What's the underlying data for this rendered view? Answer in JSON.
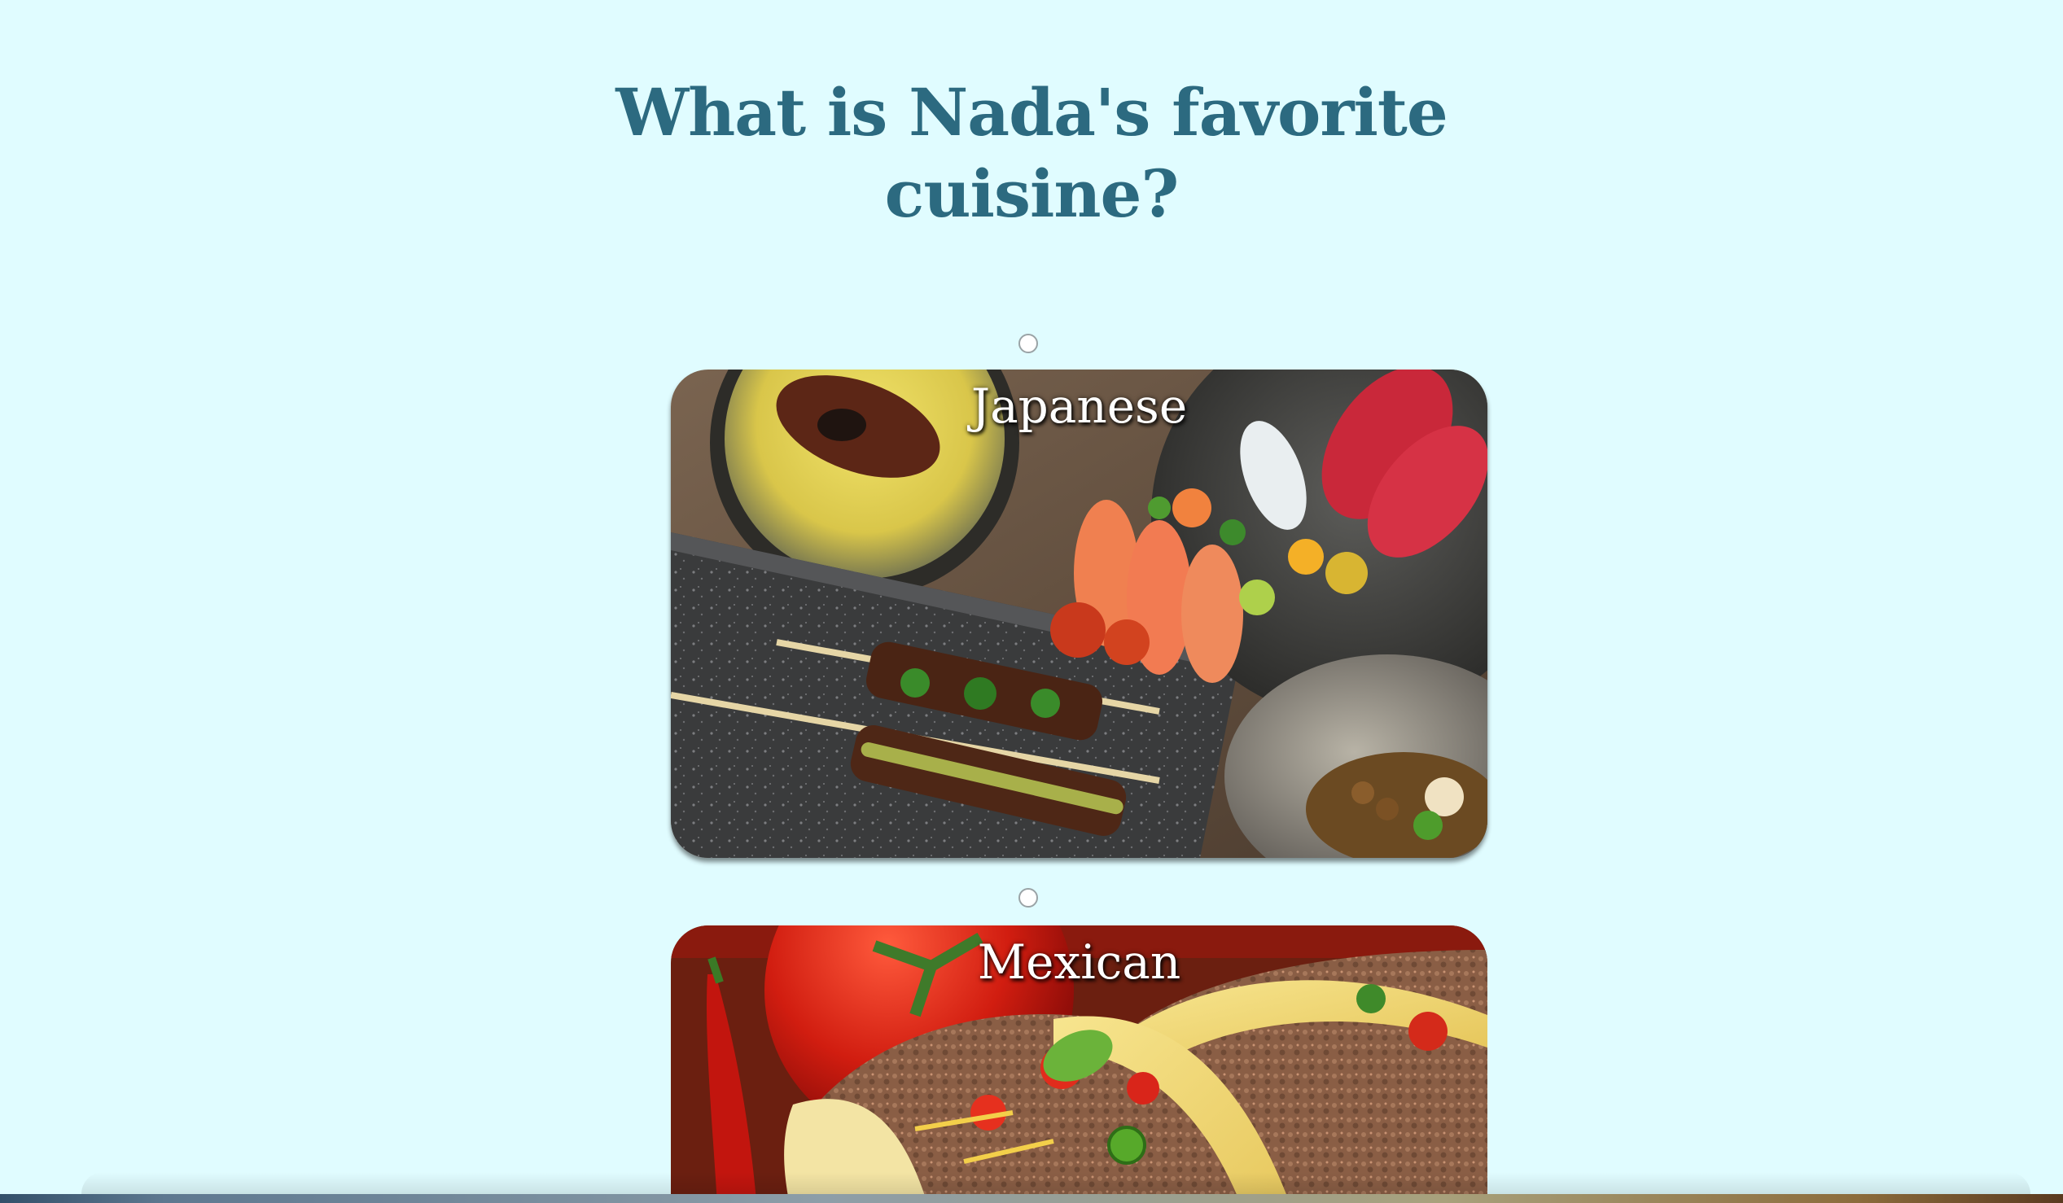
{
  "question": {
    "line1": "What is Nada's favorite",
    "line2": "cuisine?"
  },
  "options": [
    {
      "label": "Japanese",
      "image": "japanese-food-photo",
      "selected": false
    },
    {
      "label": "Mexican",
      "image": "mexican-tacos-photo",
      "selected": false
    }
  ],
  "colors": {
    "background": "#e0fcff",
    "title": "#2c6a80",
    "label": "#ffffff"
  }
}
